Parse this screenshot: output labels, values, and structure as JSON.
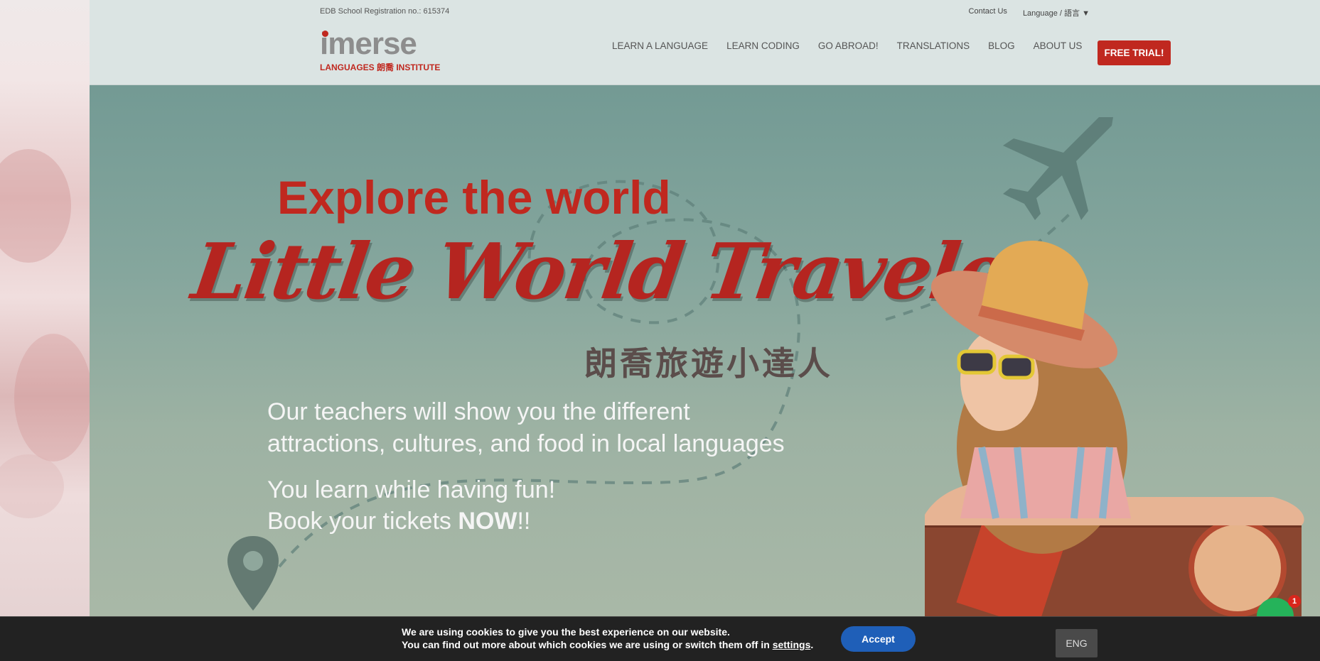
{
  "header": {
    "registration": "EDB School Registration no.: 615374",
    "contact": "Contact Us",
    "language": "Language / 語言 ▼",
    "logo_main": "imerse",
    "logo_sub": "LANGUAGES 朗喬 INSTITUTE",
    "nav": [
      "LEARN A LANGUAGE",
      "LEARN CODING",
      "GO ABROAD!",
      "TRANSLATIONS",
      "BLOG",
      "ABOUT US"
    ],
    "cta": "FREE TRIAL!"
  },
  "hero": {
    "headline1": "Explore the world",
    "headline2": "Little World Traveler",
    "chinese_title": "朗喬旅遊小達人",
    "para1_line1": "Our teachers will show you the different",
    "para1_line2": "attractions, cultures, and food in local languages",
    "para2_line1": "You learn while having fun!",
    "para2_line2_prefix": "Book your tickets ",
    "para2_line2_bold": "NOW",
    "para2_line2_suffix": "!!"
  },
  "chat": {
    "badge": "1"
  },
  "cookie": {
    "line1": "We are using cookies to give you the best experience on our website.",
    "line2_prefix": "You can find out more about which cookies we are using or switch them off in ",
    "line2_link": "settings",
    "line2_suffix": ".",
    "accept": "Accept",
    "lang": "ENG"
  },
  "colors": {
    "brand_red": "#c0281f",
    "hero_bg": "#85a69d",
    "accept_blue": "#1f5fb8"
  }
}
